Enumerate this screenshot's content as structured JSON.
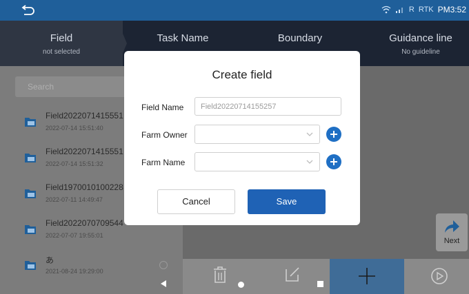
{
  "status_bar": {
    "signal_1": "R",
    "rtk_label": "RTK",
    "time": "PM3:52"
  },
  "tabs": [
    {
      "title": "Field",
      "subtitle": "not selected"
    },
    {
      "title": "Task Name",
      "subtitle": ""
    },
    {
      "title": "Boundary",
      "subtitle": ""
    },
    {
      "title": "Guidance line",
      "subtitle": "No guideline"
    }
  ],
  "search": {
    "placeholder": "Search"
  },
  "fields": [
    {
      "name": "Field2022071415551",
      "date": "2022-07-14 15:51:40"
    },
    {
      "name": "Field2022071415551",
      "date": "2022-07-14 15:51:32"
    },
    {
      "name": "Field1970010100228",
      "date": "2022-07-11 14:49:47"
    },
    {
      "name": "Field2022070709544",
      "date": "2022-07-07 19:55:01"
    },
    {
      "name": "あ",
      "date": "2021-08-24 19:29:00"
    }
  ],
  "next_button": {
    "label": "Next"
  },
  "dialog": {
    "title": "Create field",
    "field_name_label": "Field Name",
    "field_name_value": "Field20220714155257",
    "farm_owner_label": "Farm Owner",
    "farm_owner_value": "",
    "farm_name_label": "Farm Name",
    "farm_name_value": "",
    "cancel_label": "Cancel",
    "save_label": "Save"
  },
  "colors": {
    "accent": "#1f62b5",
    "statusbar": "#1f5f9a",
    "header": "#1c2433"
  },
  "icons": [
    "back-icon",
    "wifi-icon",
    "signal-icon",
    "folder-icon",
    "trash-icon",
    "edit-icon",
    "plus-icon",
    "play-icon",
    "arrow-right-icon",
    "chevron-down-icon"
  ]
}
